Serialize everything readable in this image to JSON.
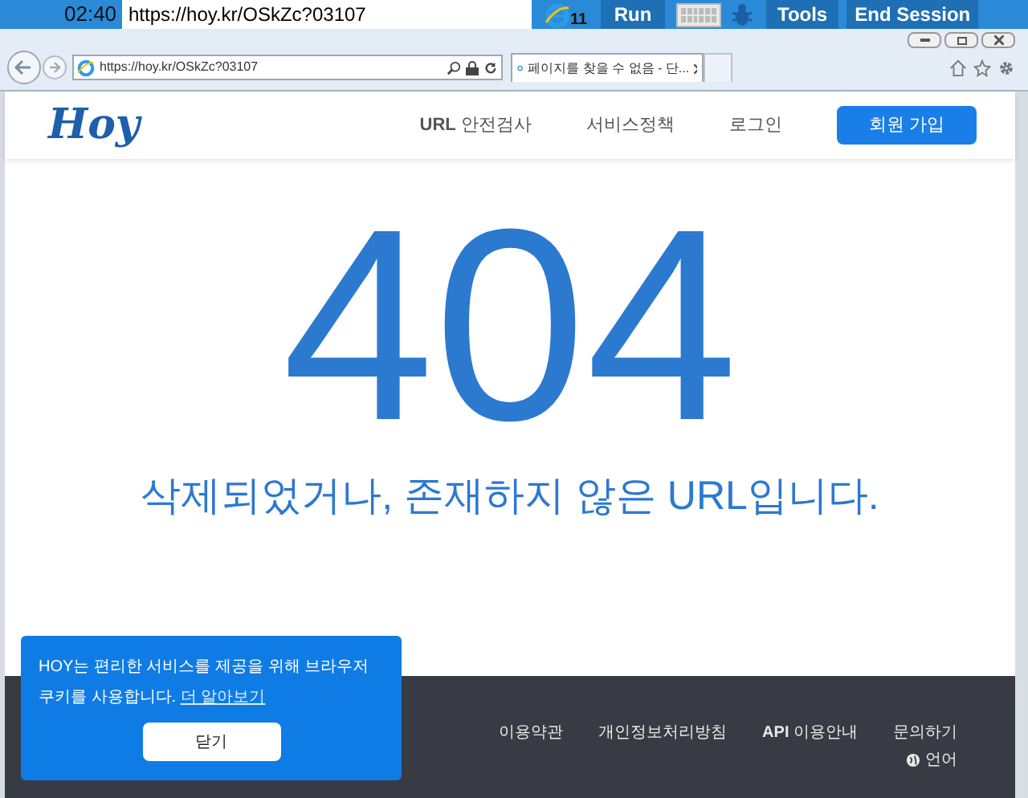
{
  "remote_bar": {
    "time": "02:40",
    "url": "https://hoy.kr/OSkZc?03107",
    "browser_version": "11",
    "buttons": [
      "Run",
      "Tools",
      "End Session"
    ]
  },
  "browser": {
    "address": "https://hoy.kr/OSkZc?03107",
    "tab_title": "페이지를 찾을 수 없음 - 단..."
  },
  "site": {
    "logo": "Hoy",
    "nav": [
      {
        "label": "**URL** 안전검사",
        "kind": "link"
      },
      {
        "label": "서비스정책",
        "kind": "link"
      },
      {
        "label": "로그인",
        "kind": "link"
      },
      {
        "label": "회원 가입",
        "kind": "button"
      }
    ]
  },
  "error": {
    "code": "404",
    "message": "삭제되었거나, 존재하지 않은 URL입니다."
  },
  "footer": {
    "links": [
      "이용약관",
      "개인정보처리방침",
      "**API** 이용안내",
      "문의하기"
    ],
    "language": "언어"
  },
  "cookie_notice": {
    "text": "HOY는 편리한 서비스를 제공을 위해 브라우저 쿠키를 사용합니다.",
    "link": "더 알아보기",
    "button": "닫기"
  }
}
